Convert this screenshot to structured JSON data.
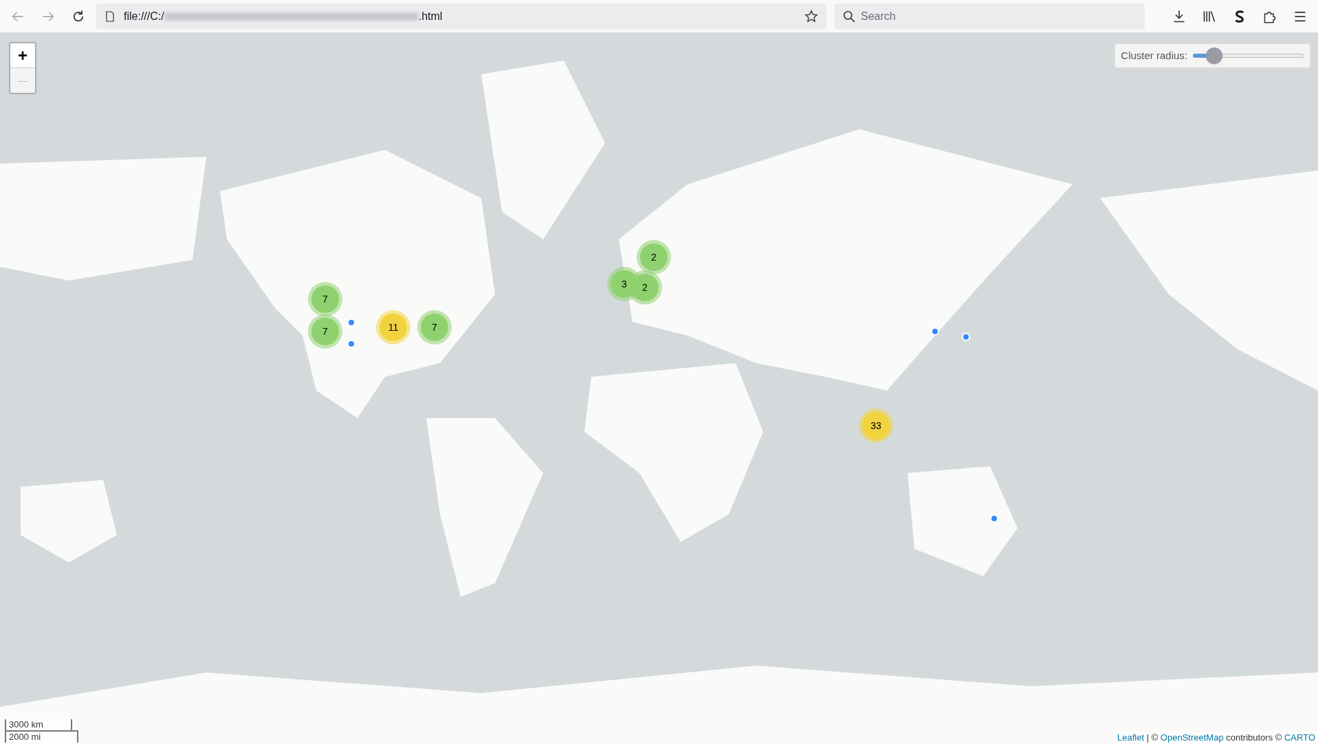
{
  "toolbar": {
    "url_start": "file:///C:/",
    "url_end": ".html",
    "search": {
      "placeholder": "Search"
    }
  },
  "map": {
    "zoom_in": {
      "label": "+",
      "disabled": false
    },
    "zoom_out": {
      "label": "—",
      "disabled": true
    },
    "cluster_radius": {
      "label": "Cluster radius:",
      "level": 0.14
    },
    "clusters": [
      {
        "count": "7",
        "color": "#8fd16f"
      },
      {
        "count": "7",
        "color": "#8fd16f"
      },
      {
        "count": "11",
        "color": "#f0d33e"
      },
      {
        "count": "7",
        "color": "#8fd16f"
      },
      {
        "count": "2",
        "color": "#8fd16f"
      },
      {
        "count": "3",
        "color": "#8fd16f"
      },
      {
        "count": "2",
        "color": "#8fd16f"
      },
      {
        "count": "33",
        "color": "#f0d33e"
      }
    ],
    "scale": [
      "3000 km",
      "2000 mi"
    ],
    "attribution": [
      {
        "text": "Leaflet",
        "link": true
      },
      {
        "text": " | © ",
        "link": false
      },
      {
        "text": "OpenStreetMap",
        "link": true
      },
      {
        "text": " contributors © ",
        "link": false
      },
      {
        "text": "CARTO",
        "link": true
      }
    ]
  }
}
